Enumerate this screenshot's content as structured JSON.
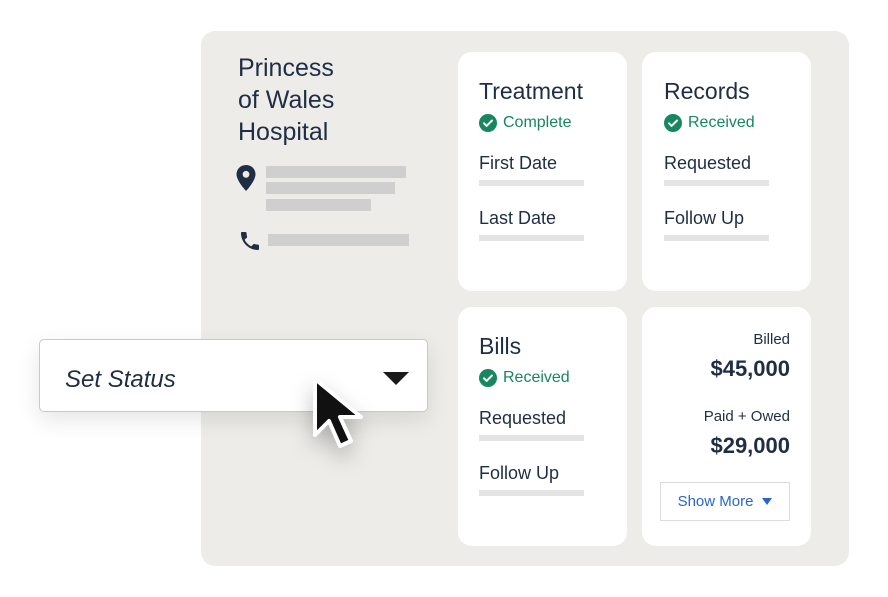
{
  "hospital": {
    "name": "Princess\nof Wales\nHospital",
    "location_icon": "map-pin-icon",
    "phone_icon": "phone-icon"
  },
  "cards": {
    "treatment": {
      "title": "Treatment",
      "status": "Complete",
      "fields": [
        "First Date",
        "Last Date"
      ]
    },
    "records": {
      "title": "Records",
      "status": "Received",
      "fields": [
        "Requested",
        "Follow Up"
      ]
    },
    "bills": {
      "title": "Bills",
      "status": "Received",
      "fields": [
        "Requested",
        "Follow Up"
      ]
    }
  },
  "totals": {
    "billed_label": "Billed",
    "billed_value": "$45,000",
    "paid_label": "Paid + Owed",
    "paid_value": "$29,000",
    "show_more": "Show More"
  },
  "set_status": {
    "label": "Set Status"
  },
  "colors": {
    "panel_bg": "#edece8",
    "text_navy": "#1f2d45",
    "status_green": "#16875f",
    "link_blue": "#2a66c9",
    "placeholder_gray": "#cfcfcf"
  }
}
